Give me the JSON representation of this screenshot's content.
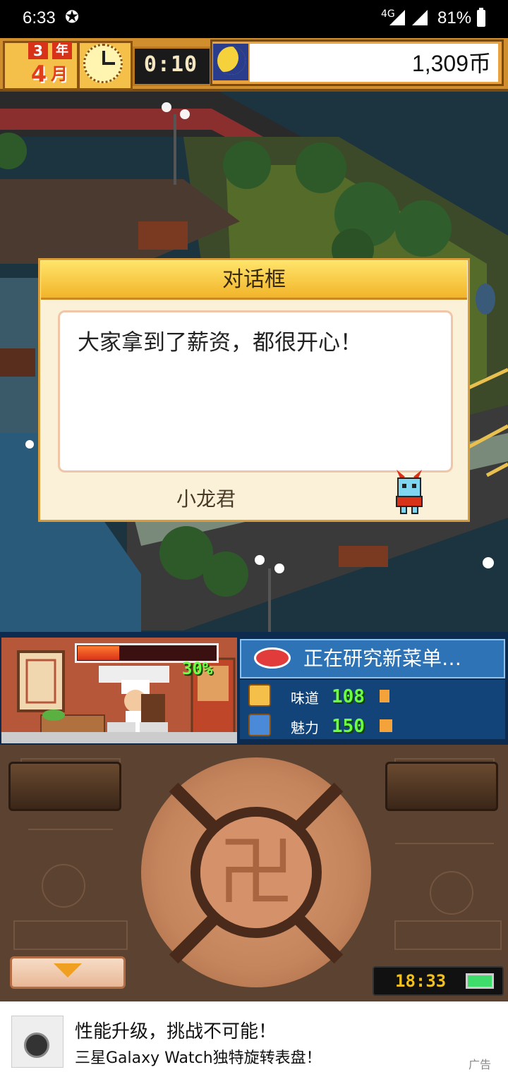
{
  "status_bar": {
    "time": "6:33",
    "network": "4G",
    "battery": "81%"
  },
  "hud": {
    "year_num": "3",
    "year_label": "年",
    "month_num": "4",
    "month_label": "月",
    "timer": "0:10",
    "money": "1,309币"
  },
  "dialog": {
    "title": "对话框",
    "text": "大家拿到了薪资，都很开心！",
    "speaker": "小龙君"
  },
  "chef": {
    "progress_pct_label": "30%",
    "progress_value": 0.3,
    "research_title": "正在研究新菜单…",
    "stats": [
      {
        "label": "味道",
        "value": "108"
      },
      {
        "label": "魅力",
        "value": "150"
      }
    ]
  },
  "controls": {
    "clock": "18:33"
  },
  "ad": {
    "line1": "性能升级，挑战不可能！",
    "line2": "三星Galaxy Watch独特旋转表盘！",
    "tag": "广告"
  },
  "colors": {
    "hud_gold": "#f5c04a",
    "progress_red": "#d83218",
    "stat_green": "#6dff44",
    "research_blue": "#2d73b6"
  }
}
